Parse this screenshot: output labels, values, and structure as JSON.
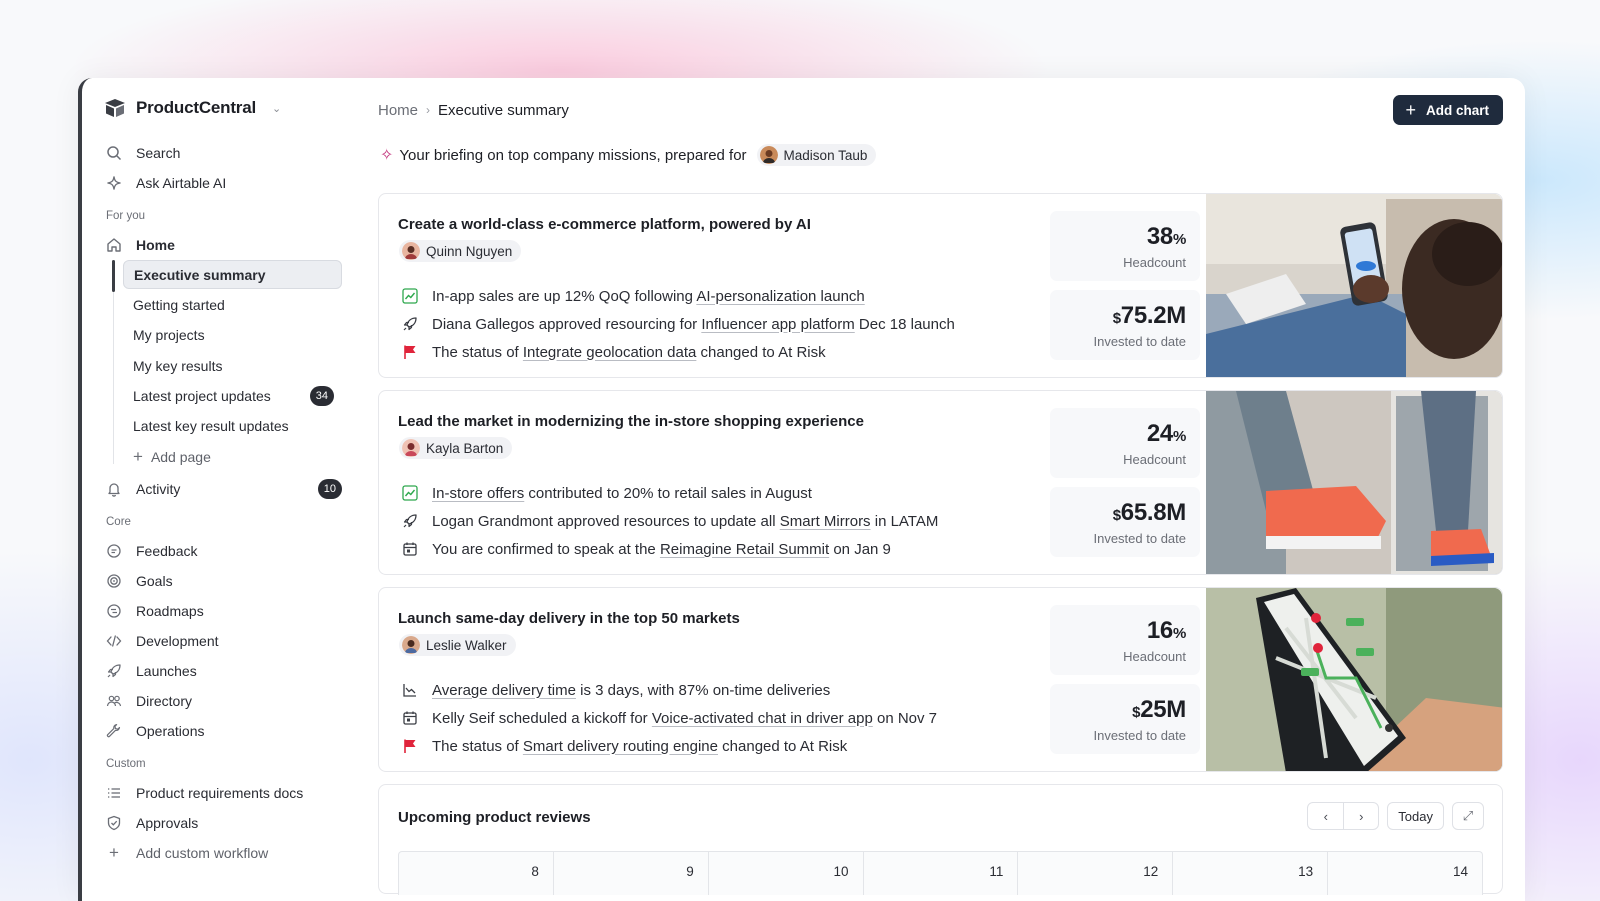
{
  "app": {
    "brand": "ProductCentral"
  },
  "sidebar": {
    "top_items": [
      {
        "label": "Search",
        "icon": "search-icon"
      },
      {
        "label": "Ask Airtable AI",
        "icon": "sparkle-icon"
      }
    ],
    "for_you_label": "For you",
    "home_label": "Home",
    "home_sub": [
      {
        "label": "Executive summary",
        "active": true
      },
      {
        "label": "Getting started"
      },
      {
        "label": "My projects"
      },
      {
        "label": "My key results"
      },
      {
        "label": "Latest project updates",
        "badge": "34"
      },
      {
        "label": "Latest key result updates"
      }
    ],
    "add_page_label": "Add page",
    "activity_label": "Activity",
    "activity_badge": "10",
    "core_label": "Core",
    "core_items": [
      {
        "label": "Feedback",
        "icon": "chat-icon"
      },
      {
        "label": "Goals",
        "icon": "target-icon"
      },
      {
        "label": "Roadmaps",
        "icon": "roadmap-icon"
      },
      {
        "label": "Development",
        "icon": "code-icon"
      },
      {
        "label": "Launches",
        "icon": "rocket-icon"
      },
      {
        "label": "Directory",
        "icon": "people-icon"
      },
      {
        "label": "Operations",
        "icon": "wrench-icon"
      }
    ],
    "custom_label": "Custom",
    "custom_items": [
      {
        "label": "Product requirements docs",
        "icon": "list-icon"
      },
      {
        "label": "Approvals",
        "icon": "shield-check-icon"
      }
    ],
    "add_custom_label": "Add custom workflow"
  },
  "header": {
    "breadcrumb_home": "Home",
    "breadcrumb_current": "Executive summary",
    "add_chart_label": "Add chart"
  },
  "briefing": {
    "text": "Your briefing on top company missions, prepared for",
    "person": "Madison Taub"
  },
  "missions": [
    {
      "title": "Create a world-class e-commerce platform, powered by AI",
      "owner": "Quinn Nguyen",
      "updates": [
        {
          "icon": "trend-up-icon",
          "parts": [
            "In-app sales are up 12% QoQ following ",
            "AI-personalization launch",
            ""
          ]
        },
        {
          "icon": "rocket-icon",
          "parts": [
            "Diana Gallegos approved resourcing for ",
            "Influencer app platform",
            " Dec 18 launch"
          ]
        },
        {
          "icon": "flag-icon",
          "parts": [
            "The status of ",
            "Integrate geolocation data",
            " changed to At Risk"
          ]
        }
      ],
      "headcount": "38",
      "headcount_unit": "%",
      "headcount_label": "Headcount",
      "invested_prefix": "$",
      "invested": "75.2M",
      "invested_label": "Invested to date"
    },
    {
      "title": "Lead the market in modernizing the in-store shopping experience",
      "owner": "Kayla Barton",
      "updates": [
        {
          "icon": "trend-up-icon",
          "parts": [
            "",
            "In-store offers",
            " contributed to 20% to retail sales in August"
          ]
        },
        {
          "icon": "rocket-icon",
          "parts": [
            "Logan Grandmont approved resources to update all ",
            "Smart Mirrors",
            " in LATAM"
          ]
        },
        {
          "icon": "calendar-icon",
          "parts": [
            "You are confirmed to speak at the ",
            "Reimagine Retail Summit",
            " on Jan 9"
          ]
        }
      ],
      "headcount": "24",
      "headcount_unit": "%",
      "headcount_label": "Headcount",
      "invested_prefix": "$",
      "invested": "65.8M",
      "invested_label": "Invested to date"
    },
    {
      "title": "Launch same-day delivery in the top 50 markets",
      "owner": "Leslie Walker",
      "updates": [
        {
          "icon": "trend-down-icon",
          "parts": [
            "",
            "Average delivery time",
            " is 3 days, with 87% on-time deliveries"
          ]
        },
        {
          "icon": "calendar-icon",
          "parts": [
            "Kelly Seif scheduled a kickoff for ",
            "Voice-activated chat in driver app",
            " on Nov 7"
          ]
        },
        {
          "icon": "flag-icon",
          "parts": [
            "The status of ",
            "Smart delivery routing engine",
            " changed to At Risk"
          ]
        }
      ],
      "headcount": "16",
      "headcount_unit": "%",
      "headcount_label": "Headcount",
      "invested_prefix": "$",
      "invested": "25M",
      "invested_label": "Invested to date"
    }
  ],
  "reviews": {
    "title": "Upcoming product reviews",
    "prev_label": "‹",
    "next_label": "›",
    "today_label": "Today",
    "expand_icon": "expand-icon",
    "days": [
      "8",
      "9",
      "10",
      "11",
      "12",
      "13",
      "14"
    ]
  },
  "colors": {
    "accent_dark": "#1f2b3d",
    "sparkle": "#c2317b",
    "trend_green": "#2ea84d",
    "flag_red": "#e0243b"
  }
}
